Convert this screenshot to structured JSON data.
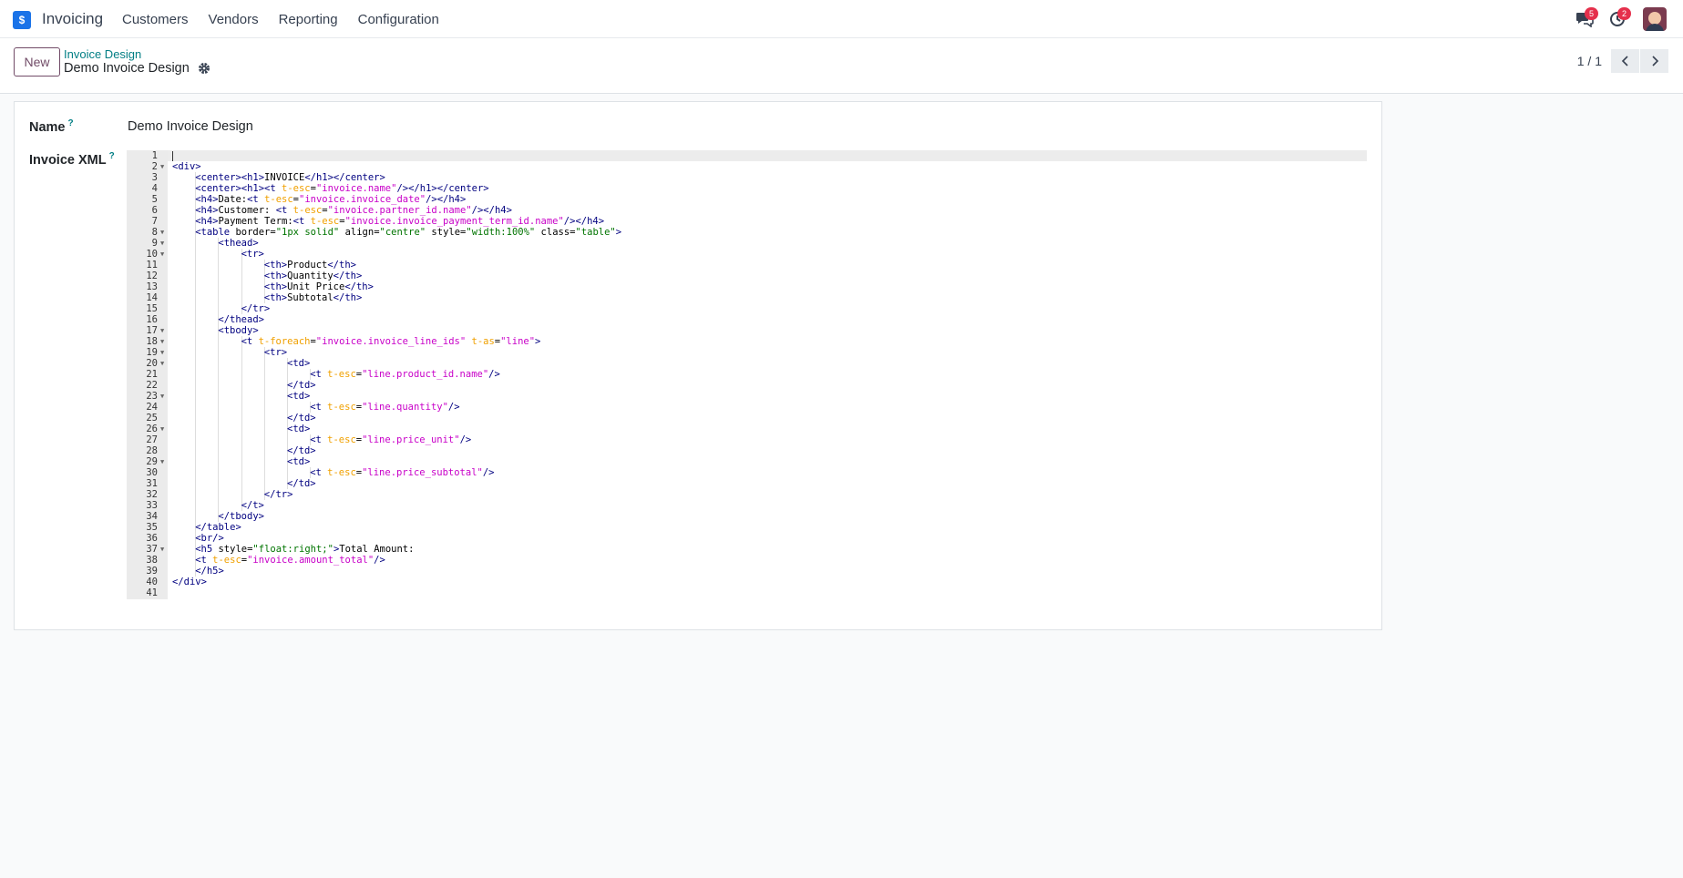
{
  "navbar": {
    "app_name": "Invoicing",
    "logo_glyph": "$",
    "menu": [
      "Customers",
      "Vendors",
      "Reporting",
      "Configuration"
    ],
    "messages_badge": "5",
    "activities_badge": "2"
  },
  "control_panel": {
    "new_label": "New",
    "breadcrumb": "Invoice Design",
    "record_title": "Demo Invoice Design",
    "pager": "1 / 1"
  },
  "form": {
    "name_label": "Name",
    "name_value": "Demo Invoice Design",
    "xml_label": "Invoice XML",
    "help_mark": "?"
  },
  "editor": {
    "lines": [
      {
        "n": "1",
        "i": 0,
        "f": false,
        "s": [
          [
            "p",
            ""
          ]
        ]
      },
      {
        "n": "2",
        "i": 0,
        "f": true,
        "s": [
          [
            "t",
            "<div>"
          ]
        ]
      },
      {
        "n": "3",
        "i": 1,
        "f": false,
        "s": [
          [
            "t",
            "<center><h1>"
          ],
          [
            "p",
            "INVOICE"
          ],
          [
            "t",
            "</h1></center>"
          ]
        ]
      },
      {
        "n": "4",
        "i": 1,
        "f": false,
        "s": [
          [
            "t",
            "<center><h1><t "
          ],
          [
            "a",
            "t-esc"
          ],
          [
            "p",
            "="
          ],
          [
            "s",
            "\"invoice.name\""
          ],
          [
            "t",
            "/></h1></center>"
          ]
        ]
      },
      {
        "n": "5",
        "i": 1,
        "f": false,
        "s": [
          [
            "t",
            "<h4>"
          ],
          [
            "p",
            "Date:"
          ],
          [
            "t",
            "<t "
          ],
          [
            "a",
            "t-esc"
          ],
          [
            "p",
            "="
          ],
          [
            "s",
            "\"invoice.invoice_date\""
          ],
          [
            "t",
            "/></h4>"
          ]
        ]
      },
      {
        "n": "6",
        "i": 1,
        "f": false,
        "s": [
          [
            "t",
            "<h4>"
          ],
          [
            "p",
            "Customer: "
          ],
          [
            "t",
            "<t "
          ],
          [
            "a",
            "t-esc"
          ],
          [
            "p",
            "="
          ],
          [
            "s",
            "\"invoice.partner_id.name\""
          ],
          [
            "t",
            "/></h4>"
          ]
        ]
      },
      {
        "n": "7",
        "i": 1,
        "f": false,
        "s": [
          [
            "t",
            "<h4>"
          ],
          [
            "p",
            "Payment Term:"
          ],
          [
            "t",
            "<t "
          ],
          [
            "a",
            "t-esc"
          ],
          [
            "p",
            "="
          ],
          [
            "s",
            "\"invoice.invoice_payment_term_id.name\""
          ],
          [
            "t",
            "/></h4>"
          ]
        ]
      },
      {
        "n": "8",
        "i": 1,
        "f": true,
        "s": [
          [
            "t",
            "<table "
          ],
          [
            "k",
            "border"
          ],
          [
            "p",
            "="
          ],
          [
            "g",
            "\"1px solid\""
          ],
          [
            "k",
            " align"
          ],
          [
            "p",
            "="
          ],
          [
            "g",
            "\"centre\""
          ],
          [
            "k",
            " style"
          ],
          [
            "p",
            "="
          ],
          [
            "g",
            "\"width:100%\""
          ],
          [
            "k",
            " class"
          ],
          [
            "p",
            "="
          ],
          [
            "g",
            "\"table\""
          ],
          [
            "t",
            ">"
          ]
        ]
      },
      {
        "n": "9",
        "i": 2,
        "f": true,
        "s": [
          [
            "t",
            "<thead>"
          ]
        ]
      },
      {
        "n": "10",
        "i": 3,
        "f": true,
        "s": [
          [
            "t",
            "<tr>"
          ]
        ]
      },
      {
        "n": "11",
        "i": 4,
        "f": false,
        "s": [
          [
            "t",
            "<th>"
          ],
          [
            "p",
            "Product"
          ],
          [
            "t",
            "</th>"
          ]
        ]
      },
      {
        "n": "12",
        "i": 4,
        "f": false,
        "s": [
          [
            "t",
            "<th>"
          ],
          [
            "p",
            "Quantity"
          ],
          [
            "t",
            "</th>"
          ]
        ]
      },
      {
        "n": "13",
        "i": 4,
        "f": false,
        "s": [
          [
            "t",
            "<th>"
          ],
          [
            "p",
            "Unit Price"
          ],
          [
            "t",
            "</th>"
          ]
        ]
      },
      {
        "n": "14",
        "i": 4,
        "f": false,
        "s": [
          [
            "t",
            "<th>"
          ],
          [
            "p",
            "Subtotal"
          ],
          [
            "t",
            "</th>"
          ]
        ]
      },
      {
        "n": "15",
        "i": 3,
        "f": false,
        "s": [
          [
            "t",
            "</tr>"
          ]
        ]
      },
      {
        "n": "16",
        "i": 2,
        "f": false,
        "s": [
          [
            "t",
            "</thead>"
          ]
        ]
      },
      {
        "n": "17",
        "i": 2,
        "f": true,
        "s": [
          [
            "t",
            "<tbody>"
          ]
        ]
      },
      {
        "n": "18",
        "i": 3,
        "f": true,
        "s": [
          [
            "t",
            "<t "
          ],
          [
            "a",
            "t-foreach"
          ],
          [
            "p",
            "="
          ],
          [
            "s",
            "\"invoice.invoice_line_ids\""
          ],
          [
            "a",
            " t-as"
          ],
          [
            "p",
            "="
          ],
          [
            "s",
            "\"line\""
          ],
          [
            "t",
            ">"
          ]
        ]
      },
      {
        "n": "19",
        "i": 4,
        "f": true,
        "s": [
          [
            "t",
            "<tr>"
          ]
        ]
      },
      {
        "n": "20",
        "i": 5,
        "f": true,
        "s": [
          [
            "t",
            "<td>"
          ]
        ]
      },
      {
        "n": "21",
        "i": 6,
        "f": false,
        "s": [
          [
            "t",
            "<t "
          ],
          [
            "a",
            "t-esc"
          ],
          [
            "p",
            "="
          ],
          [
            "s",
            "\"line.product_id.name\""
          ],
          [
            "t",
            "/>"
          ]
        ]
      },
      {
        "n": "22",
        "i": 5,
        "f": false,
        "s": [
          [
            "t",
            "</td>"
          ]
        ]
      },
      {
        "n": "23",
        "i": 5,
        "f": true,
        "s": [
          [
            "t",
            "<td>"
          ]
        ]
      },
      {
        "n": "24",
        "i": 6,
        "f": false,
        "s": [
          [
            "t",
            "<t "
          ],
          [
            "a",
            "t-esc"
          ],
          [
            "p",
            "="
          ],
          [
            "s",
            "\"line.quantity\""
          ],
          [
            "t",
            "/>"
          ]
        ]
      },
      {
        "n": "25",
        "i": 5,
        "f": false,
        "s": [
          [
            "t",
            "</td>"
          ]
        ]
      },
      {
        "n": "26",
        "i": 5,
        "f": true,
        "s": [
          [
            "t",
            "<td>"
          ]
        ]
      },
      {
        "n": "27",
        "i": 6,
        "f": false,
        "s": [
          [
            "t",
            "<t "
          ],
          [
            "a",
            "t-esc"
          ],
          [
            "p",
            "="
          ],
          [
            "s",
            "\"line.price_unit\""
          ],
          [
            "t",
            "/>"
          ]
        ]
      },
      {
        "n": "28",
        "i": 5,
        "f": false,
        "s": [
          [
            "t",
            "</td>"
          ]
        ]
      },
      {
        "n": "29",
        "i": 5,
        "f": true,
        "s": [
          [
            "t",
            "<td>"
          ]
        ]
      },
      {
        "n": "30",
        "i": 6,
        "f": false,
        "s": [
          [
            "t",
            "<t "
          ],
          [
            "a",
            "t-esc"
          ],
          [
            "p",
            "="
          ],
          [
            "s",
            "\"line.price_subtotal\""
          ],
          [
            "t",
            "/>"
          ]
        ]
      },
      {
        "n": "31",
        "i": 5,
        "f": false,
        "s": [
          [
            "t",
            "</td>"
          ]
        ]
      },
      {
        "n": "32",
        "i": 4,
        "f": false,
        "s": [
          [
            "t",
            "</tr>"
          ]
        ]
      },
      {
        "n": "33",
        "i": 3,
        "f": false,
        "s": [
          [
            "t",
            "</t>"
          ]
        ]
      },
      {
        "n": "34",
        "i": 2,
        "f": false,
        "s": [
          [
            "t",
            "</tbody>"
          ]
        ]
      },
      {
        "n": "35",
        "i": 1,
        "f": false,
        "s": [
          [
            "t",
            "</table>"
          ]
        ]
      },
      {
        "n": "36",
        "i": 1,
        "f": false,
        "s": [
          [
            "t",
            "<br/>"
          ]
        ]
      },
      {
        "n": "37",
        "i": 1,
        "f": true,
        "s": [
          [
            "t",
            "<h5 "
          ],
          [
            "k",
            "style"
          ],
          [
            "p",
            "="
          ],
          [
            "g",
            "\"float:right;\""
          ],
          [
            "t",
            ">"
          ],
          [
            "p",
            "Total Amount:"
          ]
        ]
      },
      {
        "n": "38",
        "i": 1,
        "f": false,
        "s": [
          [
            "t",
            "<t "
          ],
          [
            "a",
            "t-esc"
          ],
          [
            "p",
            "="
          ],
          [
            "s",
            "\"invoice.amount_total\""
          ],
          [
            "t",
            "/>"
          ]
        ]
      },
      {
        "n": "39",
        "i": 1,
        "f": false,
        "s": [
          [
            "t",
            "</h5>"
          ]
        ]
      },
      {
        "n": "40",
        "i": 0,
        "f": false,
        "s": [
          [
            "t",
            "</div>"
          ]
        ]
      },
      {
        "n": "41",
        "i": 0,
        "f": false,
        "s": [
          [
            "p",
            ""
          ]
        ]
      }
    ]
  }
}
